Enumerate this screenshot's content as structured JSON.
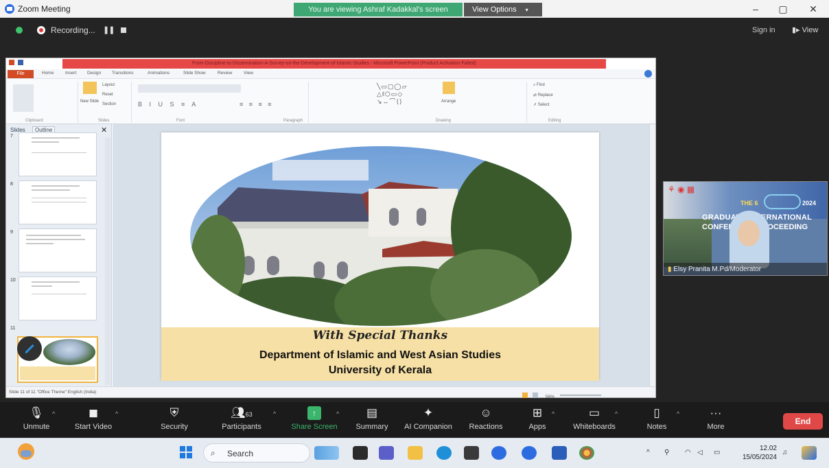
{
  "window": {
    "title": "Zoom Meeting",
    "viewing_banner": "You are viewing Ashraf Kadakkal's screen",
    "view_options": "View Options",
    "min": "–",
    "max": "▢",
    "close": "✕"
  },
  "meeting_bar": {
    "recording": "Recording...",
    "pause": "❚❚",
    "sign_in": "Sign in",
    "view": "View"
  },
  "powerpoint": {
    "title": "From-Discipline-to-Dissemination-A-Survey-on-the-Development-of-Islamic-Studies  -  Microsoft PowerPoint (Product Activation Failed)",
    "file_tab": "File",
    "tabs": [
      "Home",
      "Insert",
      "Design",
      "Transitions",
      "Animations",
      "Slide Show",
      "Review",
      "View"
    ],
    "ribbon_groups": [
      "Clipboard",
      "Slides",
      "Font",
      "Paragraph",
      "Drawing",
      "Editing"
    ],
    "ribbon_items": {
      "paste": "Paste",
      "new_slide": "New Slide",
      "layout": "Layout",
      "reset": "Reset",
      "section": "Section",
      "find": "Find",
      "replace": "Replace",
      "select": "Select",
      "arrange": "Arrange"
    },
    "panel_tabs": [
      "Slides",
      "Outline"
    ],
    "thumbnails": [
      {
        "num": "7"
      },
      {
        "num": "8"
      },
      {
        "num": "9"
      },
      {
        "num": "10"
      },
      {
        "num": "11"
      }
    ],
    "status": "Slide 11 of 11   \"Office Theme\"   English (India)",
    "zoom": "56%"
  },
  "slide": {
    "thanks": "With Special Thanks",
    "department": "Department of Islamic and West Asian Studies",
    "university": "University of Kerala"
  },
  "participant": {
    "name": "Elsy Pranita M.Pd/Moderator",
    "banner_the": "THE 6",
    "banner_year": "2024",
    "banner_line1": "GRADUATE INTERNATIONAL",
    "banner_line2": "CONFERENCE PROCEEDING"
  },
  "toolbar": {
    "unmute": "Unmute",
    "start_video": "Start Video",
    "security": "Security",
    "participants": "Participants",
    "participants_count": "63",
    "share": "Share Screen",
    "summary": "Summary",
    "ai": "AI Companion",
    "reactions": "Reactions",
    "apps": "Apps",
    "whiteboards": "Whiteboards",
    "notes": "Notes",
    "more": "More",
    "end": "End"
  },
  "taskbar": {
    "search": "Search",
    "time": "12.02",
    "date": "15/05/2024"
  },
  "colors": {
    "zoom_green": "#3fa774",
    "ppt_red": "#e64848",
    "end_red": "#e04848",
    "slide_band": "#f7e0a5"
  }
}
